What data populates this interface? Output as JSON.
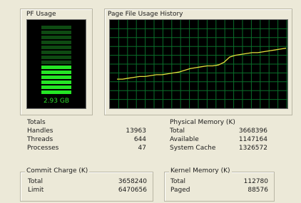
{
  "pf_usage": {
    "title": "PF Usage",
    "value": "2.93 GB",
    "fill_fraction": 0.44
  },
  "history": {
    "title": "Page File Usage History"
  },
  "totals": {
    "title": "Totals",
    "rows": [
      {
        "label": "Handles",
        "value": "13963"
      },
      {
        "label": "Threads",
        "value": "644"
      },
      {
        "label": "Processes",
        "value": "47"
      }
    ]
  },
  "physical": {
    "title": "Physical Memory (K)",
    "rows": [
      {
        "label": "Total",
        "value": "3668396"
      },
      {
        "label": "Available",
        "value": "1147164"
      },
      {
        "label": "System Cache",
        "value": "1326572"
      }
    ]
  },
  "commit": {
    "title": "Commit Charge (K)",
    "rows": [
      {
        "label": "Total",
        "value": "3658240"
      },
      {
        "label": "Limit",
        "value": "6470656"
      }
    ]
  },
  "kernel": {
    "title": "Kernel Memory (K)",
    "rows": [
      {
        "label": "Total",
        "value": "112780"
      },
      {
        "label": "Paged",
        "value": "88576"
      }
    ]
  },
  "colors": {
    "grid": "#0a6e2a",
    "gauge_on": "#25e625",
    "gauge_off": "#0e4a12",
    "history_line": "#e3df3a"
  },
  "history_series": [
    0.33,
    0.33,
    0.34,
    0.35,
    0.36,
    0.36,
    0.37,
    0.38,
    0.38,
    0.39,
    0.4,
    0.41,
    0.43,
    0.45,
    0.46,
    0.47,
    0.48,
    0.48,
    0.49,
    0.52,
    0.58,
    0.6,
    0.61,
    0.62,
    0.63,
    0.63,
    0.64,
    0.65,
    0.66,
    0.67,
    0.68
  ]
}
